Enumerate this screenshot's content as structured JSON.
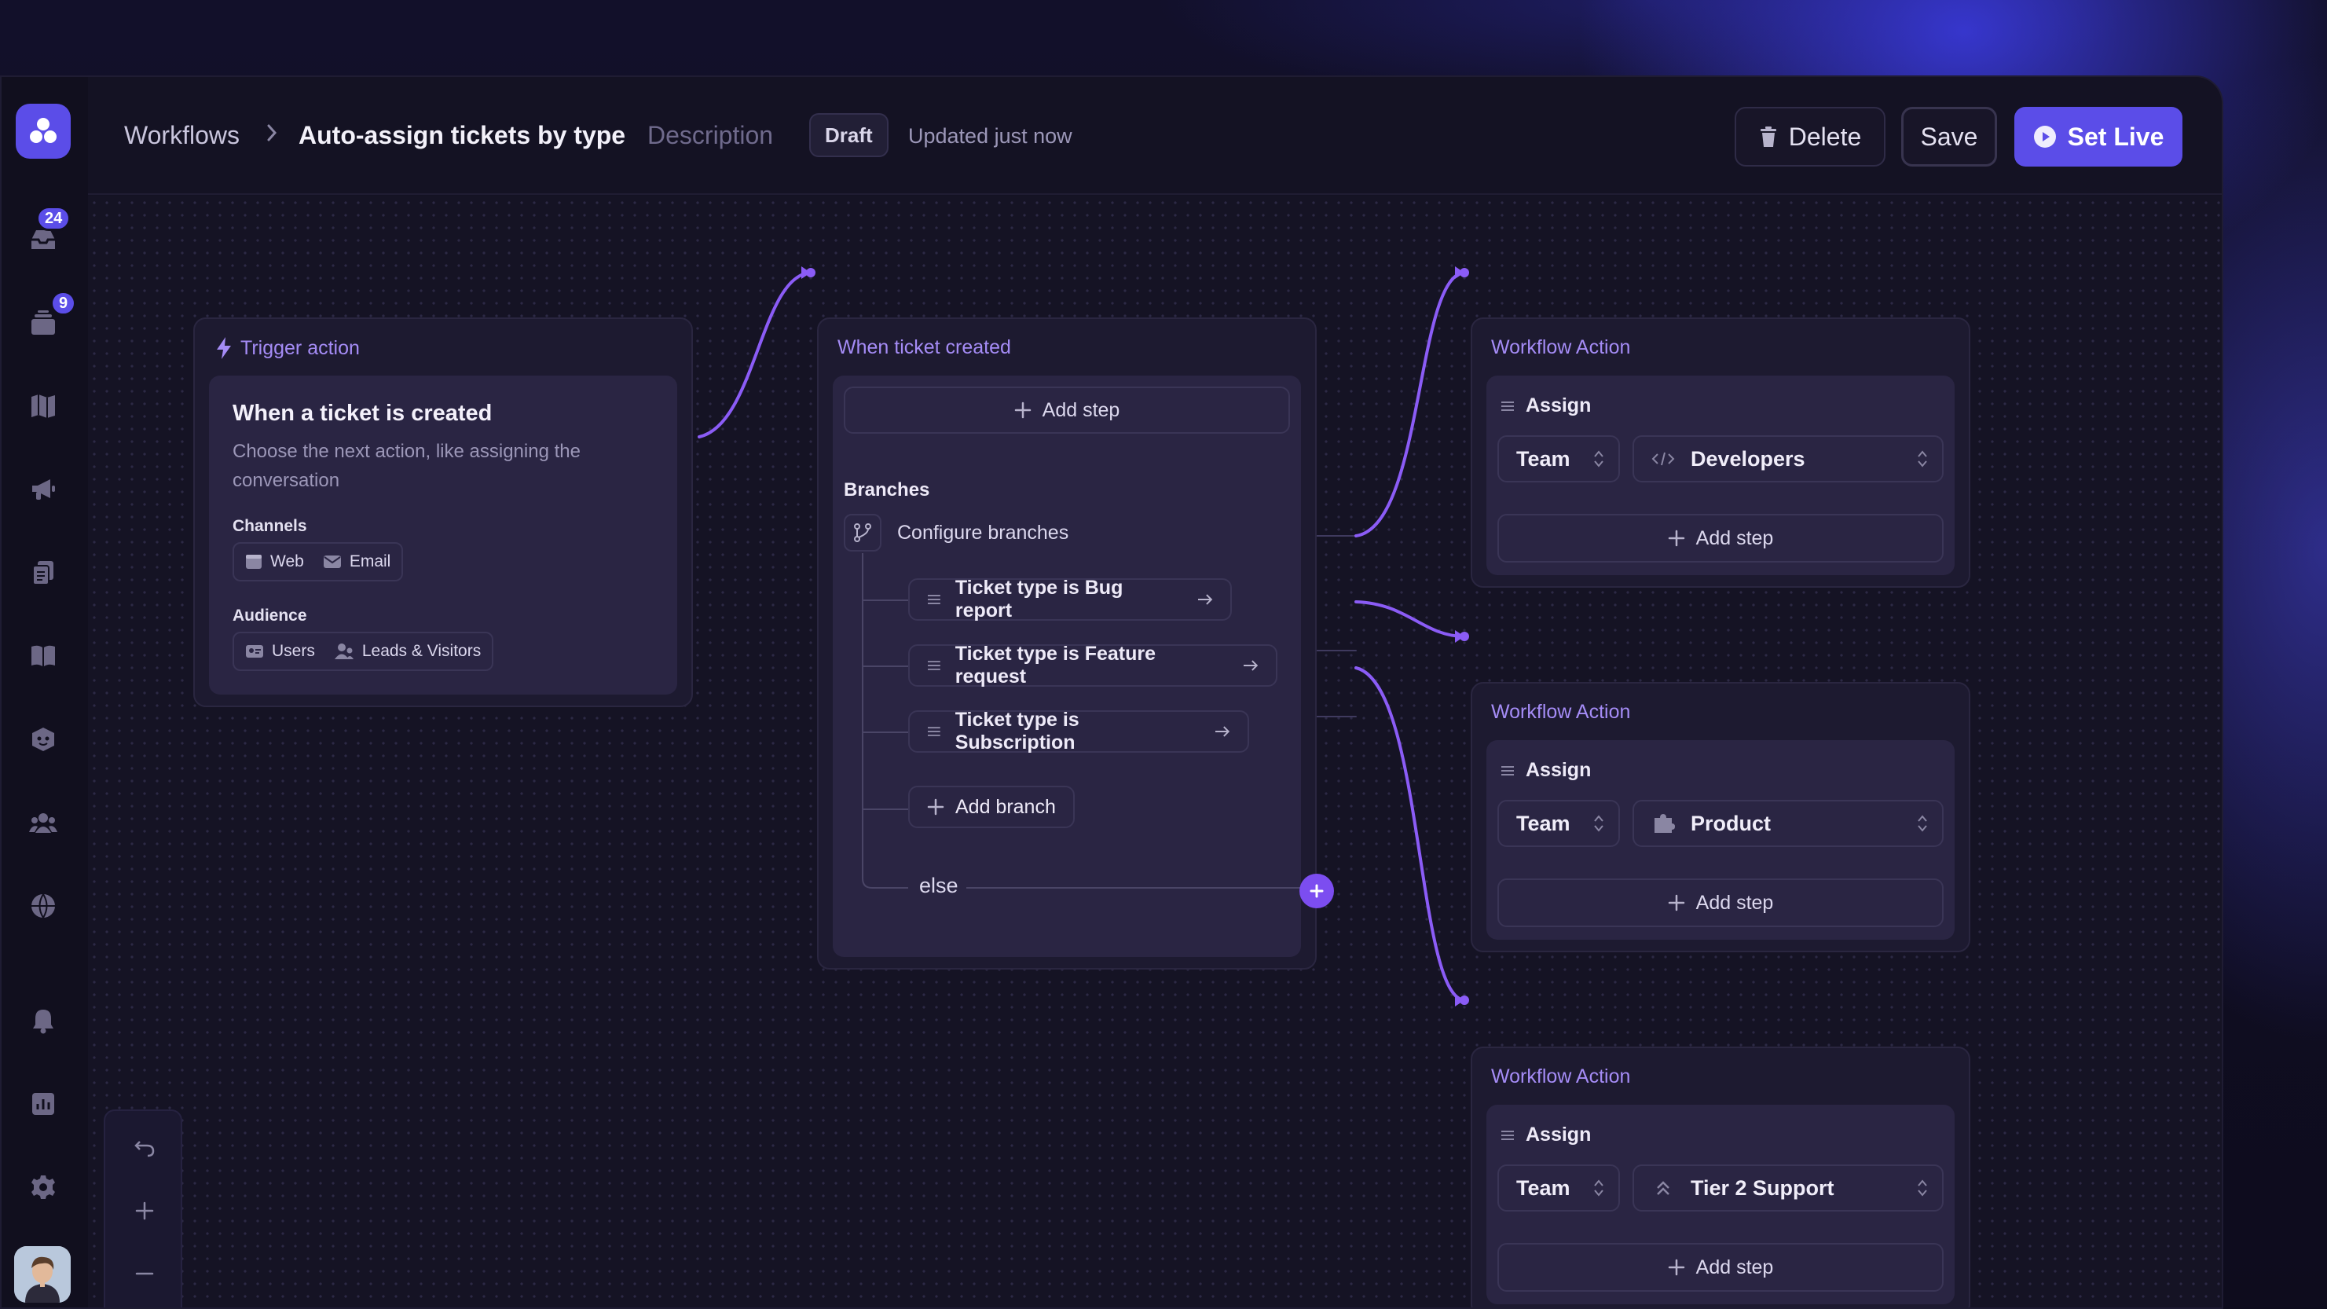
{
  "header": {
    "breadcrumb_root": "Workflows",
    "title": "Auto-assign tickets by type",
    "description_label": "Description",
    "status_badge": "Draft",
    "updated_text": "Updated just now",
    "delete_label": "Delete",
    "save_label": "Save",
    "set_live_label": "Set Live"
  },
  "sidebar": {
    "badges": {
      "inbox": "24",
      "tickets": "9"
    },
    "icons": [
      "inbox-icon",
      "tickets-icon",
      "map-icon",
      "megaphone-icon",
      "documents-icon",
      "book-icon",
      "bot-icon",
      "people-icon",
      "globe-icon",
      "bell-icon",
      "reports-icon",
      "settings-icon"
    ]
  },
  "trigger": {
    "header": "Trigger action",
    "title": "When a ticket is created",
    "description": "Choose the next action, like assigning the conversation",
    "channels_label": "Channels",
    "channels": [
      "Web",
      "Email"
    ],
    "audience_label": "Audience",
    "audience": [
      "Users",
      "Leads & Visitors"
    ]
  },
  "branch_node": {
    "header": "When ticket created",
    "add_step": "Add step",
    "branches_label": "Branches",
    "configure": "Configure branches",
    "branches": [
      "Ticket type is Bug report",
      "Ticket type is Feature request",
      "Ticket type is Subscription"
    ],
    "add_branch": "Add branch",
    "else_label": "else"
  },
  "actions": [
    {
      "header": "Workflow Action",
      "assign_label": "Assign",
      "team_label": "Team",
      "team_value": "Developers",
      "team_icon": "code-icon",
      "add_step": "Add step"
    },
    {
      "header": "Workflow Action",
      "assign_label": "Assign",
      "team_label": "Team",
      "team_value": "Product",
      "team_icon": "puzzle-icon",
      "add_step": "Add step"
    },
    {
      "header": "Workflow Action",
      "assign_label": "Assign",
      "team_label": "Team",
      "team_value": "Tier 2 Support",
      "team_icon": "double-chevron-up-icon",
      "add_step": "Add step"
    }
  ],
  "colors": {
    "accent": "#5b4de8",
    "connector": "#8b5cf6",
    "node_title": "#a58cf6"
  }
}
